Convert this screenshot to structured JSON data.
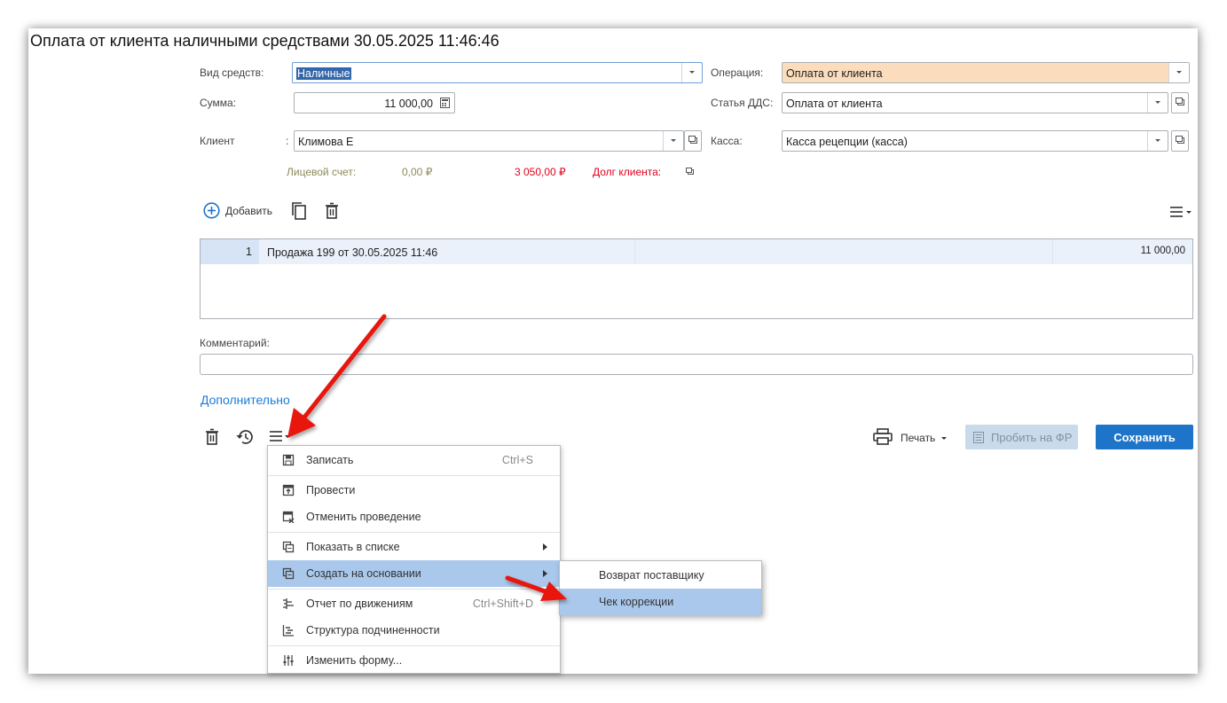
{
  "form": {
    "title": "Оплата от клиента наличными средствами 30.05.2025 11:46:46"
  },
  "fields": {
    "funds_type_label": "Вид средств:",
    "funds_type_value": "Наличные",
    "operation_label": "Операция:",
    "operation_value": "Оплата от клиента",
    "amount_label": "Сумма:",
    "amount_value": "11 000,00",
    "dds_label": "Статья ДДС:",
    "dds_value": "Оплата от клиента",
    "client_label": "Клиент",
    "client_value": "Климова Е",
    "cash_label": "Касса:",
    "cash_value": "Касса рецепции (касса)",
    "account_label": "Лицевой счет:",
    "account_value": "0,00 ₽",
    "debt_amount": "3 050,00 ₽",
    "debt_label": "Долг клиента:"
  },
  "toolbar": {
    "add_label": "Добавить"
  },
  "table": {
    "rows": [
      {
        "num": "1",
        "doc": "Продажа 199 от 30.05.2025 11:46",
        "amount": "11 000,00"
      }
    ]
  },
  "comment": {
    "label": "Комментарий:",
    "value": ""
  },
  "extra_link": "Дополнительно",
  "bottom": {
    "print_label": "Печать",
    "fiscal_label": "Пробить на ФР",
    "save_label": "Сохранить"
  },
  "menu": {
    "items": [
      {
        "label": "Записать",
        "shortcut": "Ctrl+S",
        "icon": "save-icon"
      },
      {
        "label": "Провести",
        "shortcut": "",
        "icon": "post-icon"
      },
      {
        "label": "Отменить проведение",
        "shortcut": "",
        "icon": "unpost-icon"
      },
      {
        "label": "Показать в списке",
        "shortcut": "",
        "icon": "show-list-icon"
      },
      {
        "label": "Создать на основании",
        "shortcut": "",
        "icon": "create-based-icon"
      },
      {
        "label": "Отчет по движениям",
        "shortcut": "Ctrl+Shift+D",
        "icon": "movements-icon"
      },
      {
        "label": "Структура подчиненности",
        "shortcut": "",
        "icon": "structure-icon"
      },
      {
        "label": "Изменить форму...",
        "shortcut": "",
        "icon": "settings-icon"
      }
    ]
  },
  "submenu": {
    "items": [
      {
        "label": "Возврат поставщику"
      },
      {
        "label": "Чек коррекции"
      }
    ]
  },
  "colors": {
    "primary": "#1d74c8",
    "highlight": "#aac8ec",
    "operation_bg": "#fbdcbc",
    "debt_red": "#e0001b",
    "link_blue": "#1a7dd7",
    "arrow_red": "#e8120c"
  }
}
